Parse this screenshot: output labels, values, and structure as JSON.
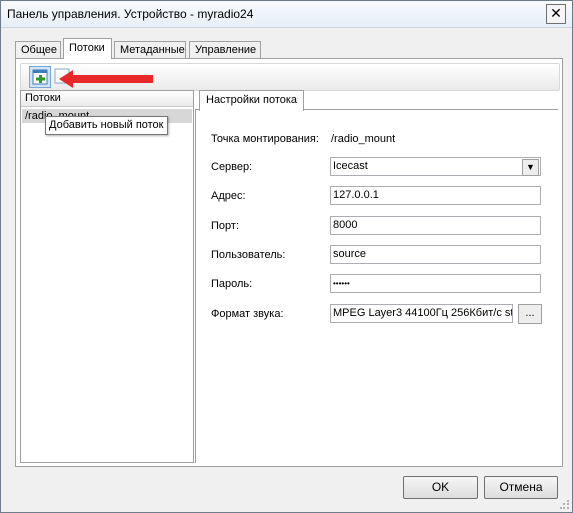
{
  "window": {
    "title": "Панель управления. Устройство - myradio24",
    "close_glyph": "✕"
  },
  "tabs": [
    {
      "label": "Общее",
      "active": false
    },
    {
      "label": "Потоки",
      "active": true
    },
    {
      "label": "Метаданные",
      "active": false
    },
    {
      "label": "Управление",
      "active": false
    }
  ],
  "toolbar": {
    "add_icon": "add-stream-icon",
    "delete_icon": "delete-stream-icon",
    "add_tooltip": "Добавить новый поток",
    "arrow_color": "#e8292a"
  },
  "stream_list": {
    "header": "Потоки",
    "items": [
      "/radio_mount"
    ]
  },
  "settings": {
    "tab_label": "Настройки потока",
    "mount_label": "Точка монтирования:",
    "mount_value": "/radio_mount",
    "server_label": "Сервер:",
    "server_value": "Icecast",
    "address_label": "Адрес:",
    "address_value": "127.0.0.1",
    "port_label": "Порт:",
    "port_value": "8000",
    "user_label": "Пользователь:",
    "user_value": "source",
    "password_label": "Пароль:",
    "password_value": "••••••",
    "format_label": "Формат звука:",
    "format_value": "MPEG Layer3 44100Гц 256Кбит/с st",
    "format_button": "..."
  },
  "buttons": {
    "ok": "OK",
    "cancel": "Отмена"
  }
}
